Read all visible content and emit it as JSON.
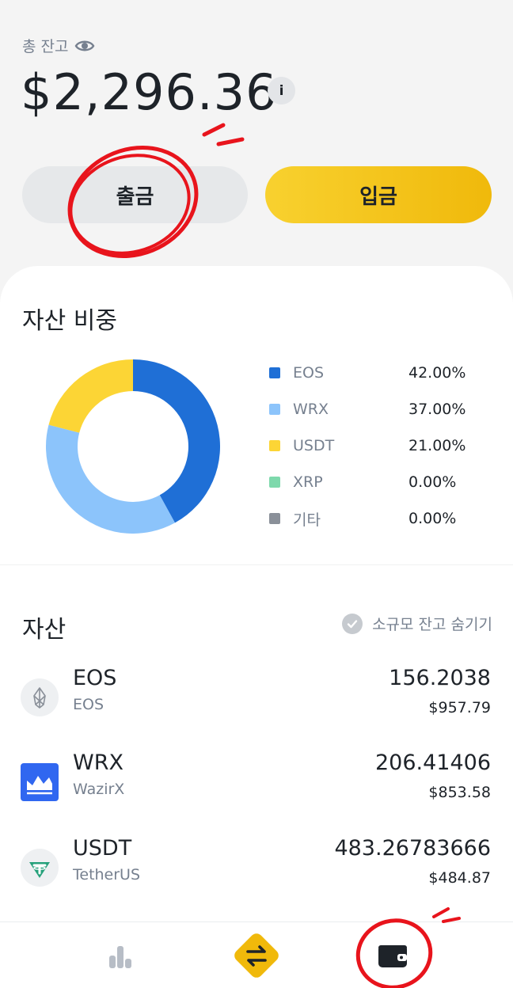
{
  "balance": {
    "label": "총 잔고",
    "value": "$2,296.36",
    "info_label": "i"
  },
  "actions": {
    "withdraw_label": "출금",
    "deposit_label": "입금"
  },
  "allocation": {
    "title": "자산 비중",
    "items": [
      {
        "name": "EOS",
        "percent": "42.00%",
        "value": 42,
        "color": "#1f6fd6"
      },
      {
        "name": "WRX",
        "percent": "37.00%",
        "value": 37,
        "color": "#8cc4fb"
      },
      {
        "name": "USDT",
        "percent": "21.00%",
        "value": 21,
        "color": "#fcd535"
      },
      {
        "name": "XRP",
        "percent": "0.00%",
        "value": 0,
        "color": "#7ed9ac"
      },
      {
        "name": "기타",
        "percent": "0.00%",
        "value": 0,
        "color": "#8a9099"
      }
    ]
  },
  "assets": {
    "title": "자산",
    "hide_small_label": "소규모 잔고 숨기기",
    "rows": [
      {
        "symbol": "EOS",
        "name": "EOS",
        "amount": "156.2038",
        "usd": "$957.79",
        "icon": "eos-icon"
      },
      {
        "symbol": "WRX",
        "name": "WazirX",
        "amount": "206.41406",
        "usd": "$853.58",
        "icon": "wazirx-icon"
      },
      {
        "symbol": "USDT",
        "name": "TetherUS",
        "amount": "483.26783666",
        "usd": "$484.87",
        "icon": "tether-icon"
      }
    ]
  },
  "nav": {
    "items": [
      "markets-icon",
      "trade-swap-icon",
      "wallet-icon"
    ]
  },
  "colors": {
    "accent": "#f0b90b",
    "annotation": "#e8141c"
  }
}
